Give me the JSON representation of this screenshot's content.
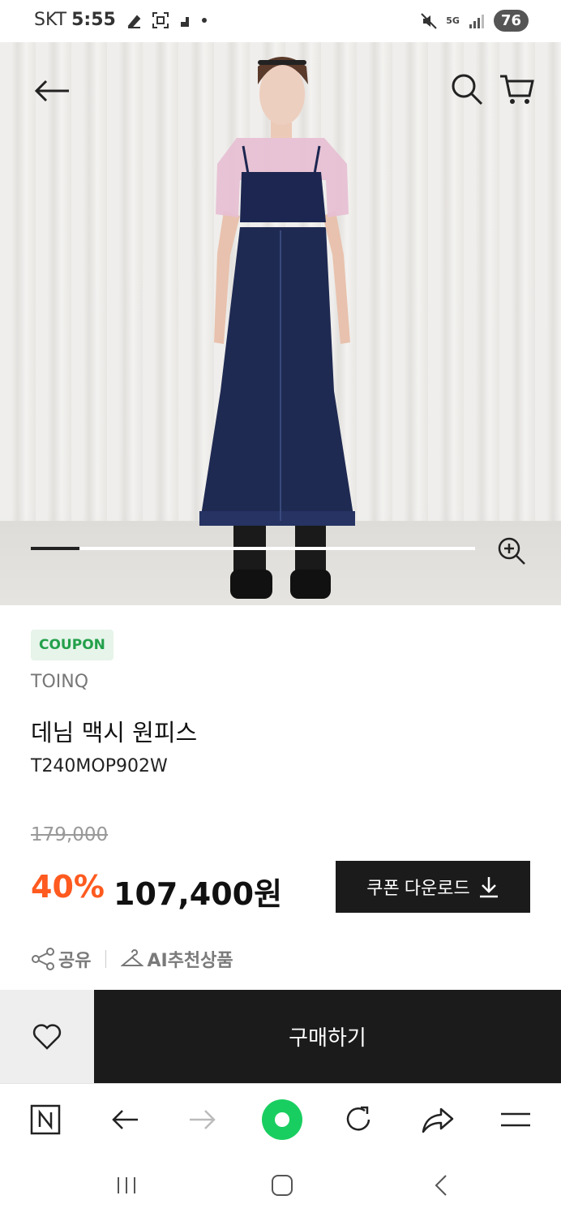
{
  "status_bar": {
    "carrier": "SKT",
    "time": "5:55",
    "network": "5G",
    "battery": "76"
  },
  "hero": {
    "image_alt": "denim maxi dress model photo",
    "gallery_progress": 0.11
  },
  "product": {
    "badge": "COUPON",
    "brand": "TOINQ",
    "name": "데님 맥시 원피스",
    "code": "T240MOP902W",
    "original_price": "179,000",
    "discount_rate": "40%",
    "sale_price": "107,400원",
    "coupon_download_label": "쿠폰 다운로드"
  },
  "links": {
    "share_label": "공유",
    "ai_recommend_label": "AI추천상품"
  },
  "actions": {
    "buy_label": "구매하기"
  },
  "colors": {
    "accent_discount": "#ff5a1f",
    "coupon_badge_text": "#23a04b",
    "dark_button": "#1b1b1b",
    "browser_green": "#19ce60"
  }
}
